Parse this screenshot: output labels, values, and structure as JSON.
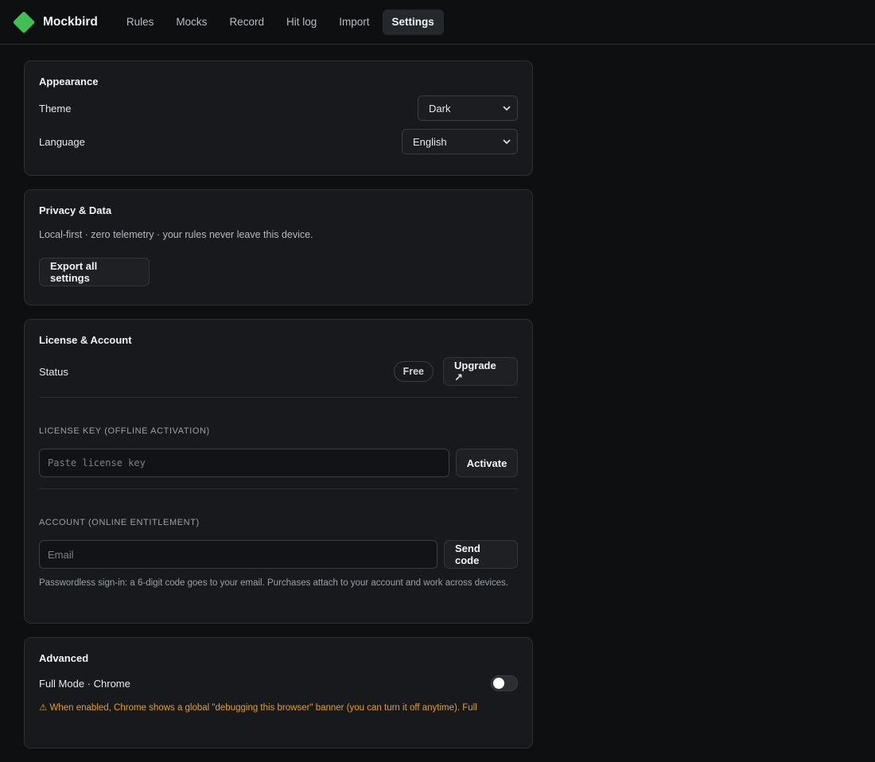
{
  "app": {
    "name": "Mockbird",
    "accent": "#3fbf54"
  },
  "nav": [
    {
      "label": "Rules",
      "active": false
    },
    {
      "label": "Mocks",
      "active": false
    },
    {
      "label": "Record",
      "active": false
    },
    {
      "label": "Hit log",
      "active": false
    },
    {
      "label": "Import",
      "active": false
    },
    {
      "label": "Settings",
      "active": true
    }
  ],
  "appearance": {
    "title": "Appearance",
    "theme_label": "Theme",
    "theme_value": "Dark",
    "language_label": "Language",
    "language_value": "English"
  },
  "privacy": {
    "title": "Privacy & Data",
    "description": "Local-first · zero telemetry · your rules never leave this device.",
    "export_label": "Export all settings"
  },
  "license": {
    "title": "License & Account",
    "status_label": "Status",
    "status_badge": "Free",
    "upgrade_label": "Upgrade ↗",
    "key_section": "LICENSE KEY (OFFLINE ACTIVATION)",
    "key_placeholder": "Paste license key",
    "activate_label": "Activate",
    "account_section": "ACCOUNT (ONLINE ENTITLEMENT)",
    "email_placeholder": "Email",
    "send_code_label": "Send code",
    "help": "Passwordless sign-in: a 6-digit code goes to your email. Purchases attach to your account and work across devices."
  },
  "advanced": {
    "title": "Advanced",
    "full_mode_label": "Full Mode · Chrome",
    "full_mode_enabled": false,
    "warning": "⚠ When enabled, Chrome shows a global \"debugging this browser\" banner (you can turn it off anytime). Full"
  }
}
